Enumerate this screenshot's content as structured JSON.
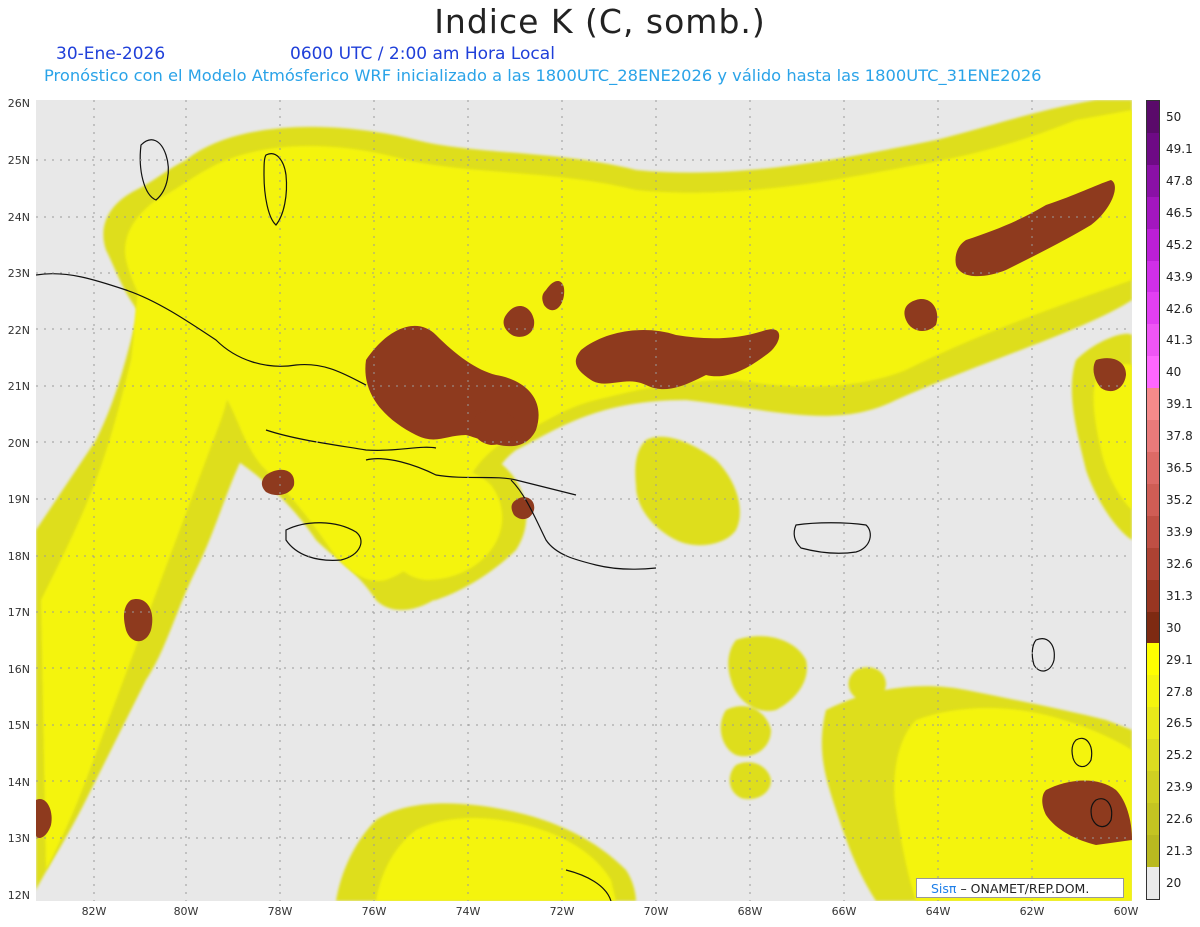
{
  "header": {
    "title": "Indice K (C, somb.)",
    "date": "30-Ene-2026",
    "time": "0600 UTC / 2:00 am Hora Local",
    "subtitle": "Pronóstico con el Modelo Atmósferico WRF inicializado a las 1800UTC_28ENE2026 y válido hasta las  1800UTC_31ENE2026"
  },
  "axes": {
    "lat_labels": [
      "26N",
      "25N",
      "24N",
      "23N",
      "22N",
      "21N",
      "20N",
      "19N",
      "18N",
      "17N",
      "16N",
      "15N",
      "14N",
      "13N",
      "12N"
    ],
    "lon_labels": [
      "82W",
      "80W",
      "78W",
      "76W",
      "74W",
      "72W",
      "70W",
      "68W",
      "66W",
      "64W",
      "62W",
      "60W"
    ]
  },
  "colorbar": {
    "labels": [
      "50",
      "49.1",
      "47.8",
      "46.5",
      "45.2",
      "43.9",
      "42.6",
      "41.3",
      "40",
      "39.1",
      "37.8",
      "36.5",
      "35.2",
      "33.9",
      "32.6",
      "31.3",
      "30",
      "29.1",
      "27.8",
      "26.5",
      "25.2",
      "23.9",
      "22.6",
      "21.3",
      "20"
    ],
    "colors": [
      "#5a0a6a",
      "#6e0a85",
      "#8a10a6",
      "#a316bf",
      "#bb1fd6",
      "#d02fe8",
      "#e23ff2",
      "#ef55f5",
      "#ff66ff",
      "#f58a8a",
      "#e97a7a",
      "#dc6a66",
      "#cf5d55",
      "#bf4f44",
      "#ad4233",
      "#983622",
      "#7e2a12",
      "#ffff00",
      "#f4f40e",
      "#e8e81a",
      "#dbdb20",
      "#cfcf22",
      "#c4c422",
      "#b9b920",
      "#eaeaea"
    ]
  },
  "credit": {
    "logo": "Sisπ",
    "text": "– ONAMET/REP.DOM."
  }
}
